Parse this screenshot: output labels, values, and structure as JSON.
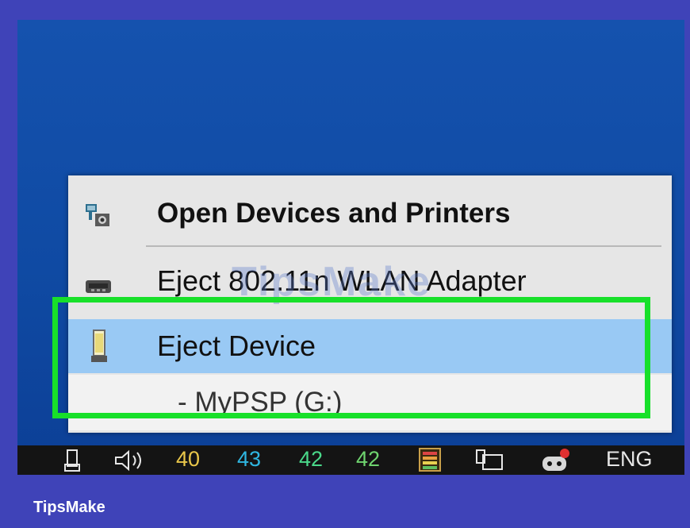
{
  "context_menu": {
    "items": [
      {
        "label": "Open Devices and Printers",
        "icon": "devices-printers-icon"
      },
      {
        "label": "Eject 802.11n WLAN Adapter",
        "icon": "usb-adapter-icon"
      },
      {
        "label": "Eject Device",
        "icon": "usb-drive-icon"
      },
      {
        "label": "- MyPSP (G:)"
      }
    ]
  },
  "watermark": "TipsMake",
  "taskbar": {
    "tray_numbers": [
      {
        "text": "40",
        "color": "#e8c64a"
      },
      {
        "text": "43",
        "color": "#2fb6e0"
      },
      {
        "text": "42",
        "color": "#4ad98a"
      },
      {
        "text": "42",
        "color": "#6fd46f"
      }
    ],
    "language": "ENG",
    "icons": [
      "usb-icon",
      "volume-icon",
      "meter-icon",
      "network-icon",
      "game-controller-icon"
    ]
  },
  "footer": {
    "brand": "TipsMake"
  },
  "colors": {
    "highlight_border": "#18e02a",
    "selected_row": "#99c9f4",
    "frame_background": "#3f43b8",
    "desktop": "#1552ae"
  }
}
